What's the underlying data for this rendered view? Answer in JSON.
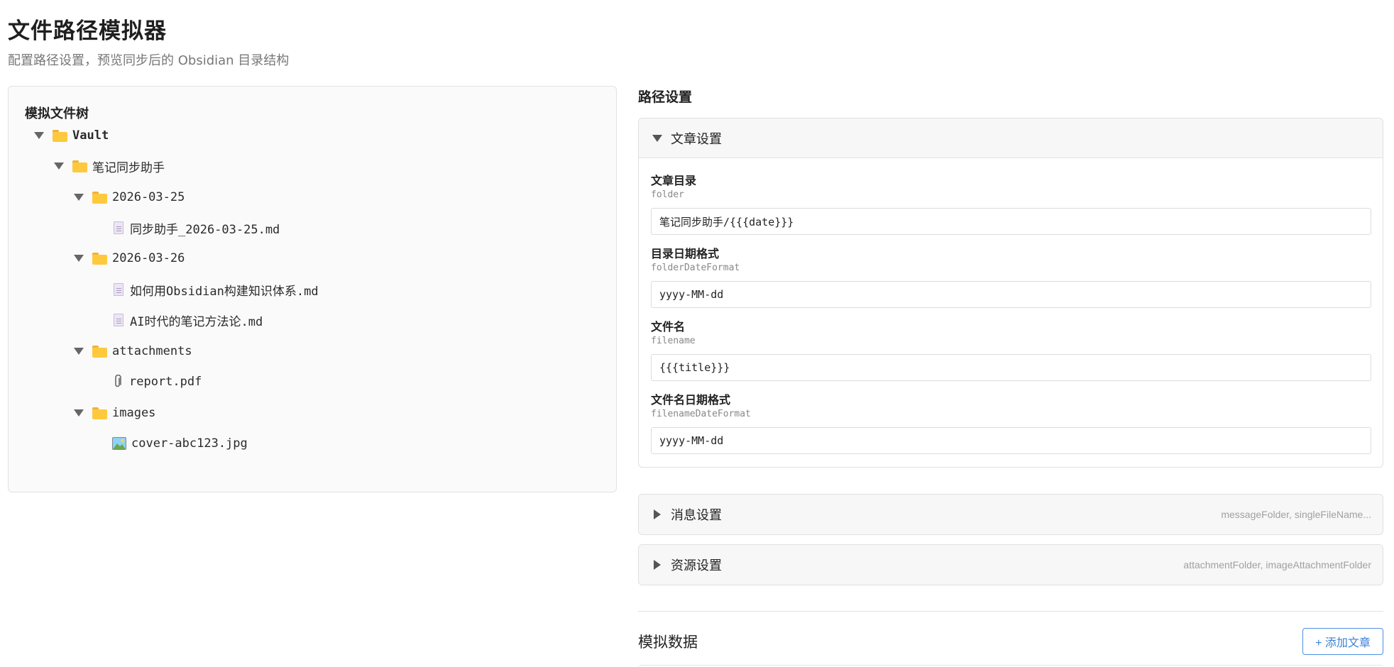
{
  "page": {
    "title": "文件路径模拟器",
    "subtitle": "配置路径设置，预览同步后的 Obsidian 目录结构"
  },
  "tree": {
    "title": "模拟文件树",
    "nodes": [
      {
        "name": "Vault",
        "type": "folder",
        "expanded": true,
        "depth": 0
      },
      {
        "name": "笔记同步助手",
        "type": "folder",
        "expanded": true,
        "depth": 1
      },
      {
        "name": "2026-03-25",
        "type": "folder",
        "expanded": true,
        "depth": 2
      },
      {
        "name": "同步助手_2026-03-25.md",
        "type": "file-md",
        "depth": 3
      },
      {
        "name": "2026-03-26",
        "type": "folder",
        "expanded": true,
        "depth": 2
      },
      {
        "name": "如何用Obsidian构建知识体系.md",
        "type": "file-md",
        "depth": 3
      },
      {
        "name": "AI时代的笔记方法论.md",
        "type": "file-md",
        "depth": 3
      },
      {
        "name": "attachments",
        "type": "folder",
        "expanded": true,
        "depth": 2
      },
      {
        "name": "report.pdf",
        "type": "file-attachment",
        "depth": 3
      },
      {
        "name": "images",
        "type": "folder",
        "expanded": true,
        "depth": 2
      },
      {
        "name": "cover-abc123.jpg",
        "type": "file-image",
        "depth": 3
      }
    ]
  },
  "settings": {
    "heading": "路径设置",
    "article": {
      "title": "文章设置",
      "expanded": true,
      "fields": [
        {
          "label": "文章目录",
          "key": "folder",
          "value": "笔记同步助手/{{{date}}}"
        },
        {
          "label": "目录日期格式",
          "key": "folderDateFormat",
          "value": "yyyy-MM-dd"
        },
        {
          "label": "文件名",
          "key": "filename",
          "value": "{{{title}}}"
        },
        {
          "label": "文件名日期格式",
          "key": "filenameDateFormat",
          "value": "yyyy-MM-dd"
        }
      ]
    },
    "message": {
      "title": "消息设置",
      "expanded": false,
      "hint": "messageFolder, singleFileName..."
    },
    "resource": {
      "title": "资源设置",
      "expanded": false,
      "hint": "attachmentFolder, imageAttachmentFolder"
    }
  },
  "mock": {
    "title": "模拟数据",
    "add_button": "+ 添加文章"
  },
  "colors": {
    "folder": "#ffc93e",
    "accent": "#3b82d6"
  }
}
